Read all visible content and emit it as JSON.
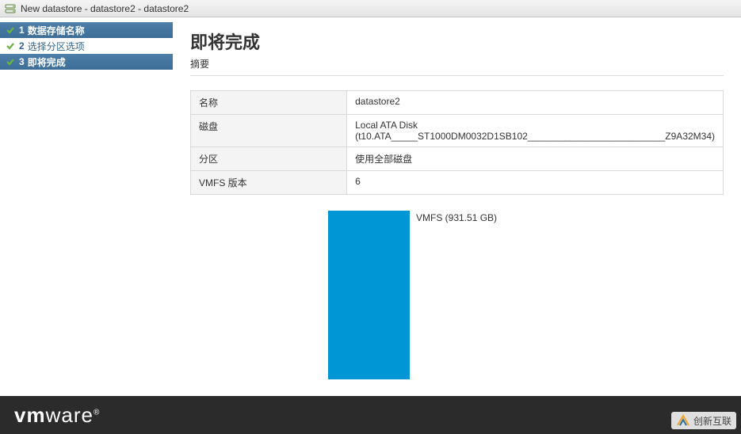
{
  "window": {
    "title": "New datastore - datastore2 - datastore2"
  },
  "wizard": {
    "steps": [
      {
        "num": "1",
        "label": "数据存储名称",
        "state": "completed"
      },
      {
        "num": "2",
        "label": "选择分区选项",
        "state": "plain"
      },
      {
        "num": "3",
        "label": "即将完成",
        "state": "current"
      }
    ]
  },
  "main": {
    "title": "即将完成",
    "subtitle": "摘要",
    "rows": [
      {
        "k": "名称",
        "v": "datastore2"
      },
      {
        "k": "磁盘",
        "v": "Local ATA Disk (t10.ATA_____ST1000DM0032D1SB102__________________________Z9A32M34)"
      },
      {
        "k": "分区",
        "v": "使用全部磁盘"
      },
      {
        "k": "VMFS 版本",
        "v": "6"
      }
    ],
    "partition_label": "VMFS  (931.51 GB)"
  },
  "footer": {
    "brand_prefix": "vm",
    "brand_suffix": "ware"
  },
  "watermark": {
    "text": "创新互联"
  }
}
